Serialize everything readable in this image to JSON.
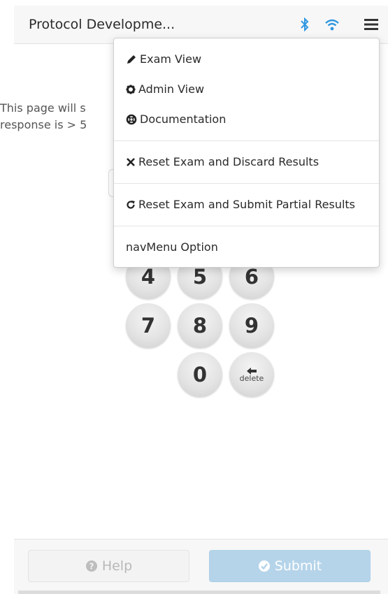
{
  "header": {
    "title": "Protocol Developme...",
    "icons": [
      "bluetooth-icon",
      "wifi-icon",
      "menu-icon"
    ],
    "status_color": "#2f97e0"
  },
  "instructions": {
    "line1": "This page will s",
    "line2": "response is > 5"
  },
  "menu": {
    "items": [
      {
        "label": "Exam View",
        "icon": "pencil-icon"
      },
      {
        "label": "Admin View",
        "icon": "cog-icon"
      },
      {
        "label": "Documentation",
        "icon": "life-ring-icon"
      },
      {
        "label": "Reset Exam and Discard Results",
        "icon": "times-icon"
      },
      {
        "label": "Reset Exam and Submit Partial Results",
        "icon": "refresh-icon"
      },
      {
        "label": "navMenu Option",
        "icon": ""
      }
    ]
  },
  "keypad": {
    "keys": [
      "4",
      "5",
      "6",
      "7",
      "8",
      "9",
      "0"
    ],
    "delete_label": "delete"
  },
  "footer": {
    "help_label": "Help",
    "submit_label": "Submit",
    "submit_color": "#b5d4ea"
  }
}
